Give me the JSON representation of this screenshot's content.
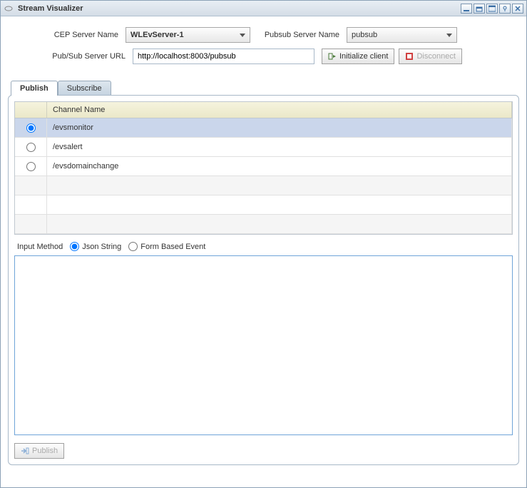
{
  "window": {
    "title": "Stream Visualizer"
  },
  "form": {
    "cep_label": "CEP Server Name",
    "cep_value": "WLEvServer-1",
    "pubsub_label": "Pubsub Server Name",
    "pubsub_value": "pubsub",
    "url_label": "Pub/Sub Server URL",
    "url_value": "http://localhost:8003/pubsub",
    "init_btn": "Initialize client",
    "disconnect_btn": "Disconnect"
  },
  "tabs": {
    "publish": "Publish",
    "subscribe": "Subscribe"
  },
  "grid": {
    "header_radio": "",
    "header_name": "Channel Name",
    "rows": [
      {
        "name": "/evsmonitor",
        "selected": true
      },
      {
        "name": "/evsalert",
        "selected": false
      },
      {
        "name": "/evsdomainchange",
        "selected": false
      }
    ]
  },
  "input_method": {
    "label": "Input Method",
    "json_label": "Json String",
    "form_label": "Form Based Event"
  },
  "textarea_value": "",
  "publish_btn": "Publish"
}
